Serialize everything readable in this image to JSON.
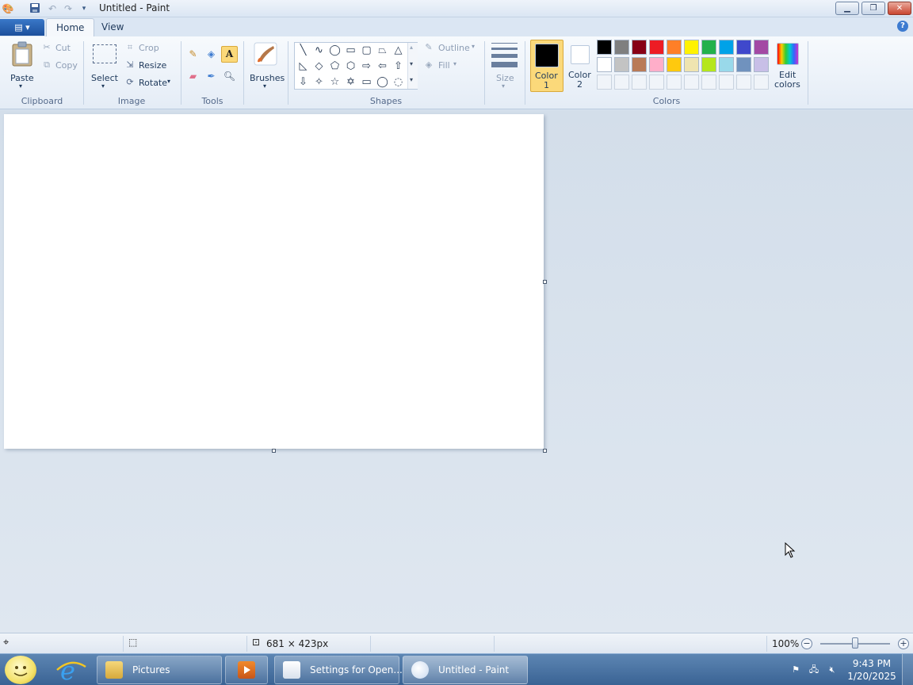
{
  "window": {
    "title": "Untitled - Paint",
    "quick_access": [
      "save-icon",
      "undo-icon",
      "redo-icon",
      "customize-dropdown-icon"
    ],
    "controls": [
      "minimize",
      "restore",
      "close"
    ]
  },
  "ribbon": {
    "app_menu_icon": "paint-menu-icon",
    "tabs": [
      {
        "label": "Home",
        "active": true
      },
      {
        "label": "View",
        "active": false
      }
    ],
    "groups": {
      "clipboard": {
        "label": "Clipboard",
        "paste": "Paste",
        "cut": "Cut",
        "copy": "Copy"
      },
      "image": {
        "label": "Image",
        "select": "Select",
        "crop": "Crop",
        "resize": "Resize",
        "rotate": "Rotate"
      },
      "tools": {
        "label": "Tools",
        "items": [
          "pencil",
          "fill",
          "text",
          "eraser",
          "color-picker",
          "magnifier"
        ],
        "active": "text"
      },
      "brushes": {
        "label": "Brushes"
      },
      "shapes": {
        "label": "Shapes",
        "outline": "Outline",
        "fill": "Fill"
      },
      "size": {
        "label": "Size"
      },
      "colors": {
        "label": "Colors",
        "color1_label": "Color",
        "color1_num": "1",
        "color2_label": "Color",
        "color2_num": "2",
        "color1": "#000000",
        "color2": "#ffffff",
        "edit": "Edit",
        "edit2": "colors",
        "palette_row1": [
          "#000000",
          "#7f7f7f",
          "#880015",
          "#ed1c24",
          "#ff7f27",
          "#fff200",
          "#22b14c",
          "#00a2e8",
          "#3f48cc",
          "#a349a4"
        ],
        "palette_row2": [
          "#ffffff",
          "#c3c3c3",
          "#b97a57",
          "#ffaec9",
          "#ffc90e",
          "#efe4b0",
          "#b5e61d",
          "#99d9ea",
          "#7092be",
          "#c8bfe7"
        ]
      }
    }
  },
  "canvas": {
    "background": "#ffffff"
  },
  "status": {
    "dimensions": "681 × 423px",
    "zoom": "100%",
    "zoom_level": 1.0
  },
  "taskbar": {
    "items": [
      {
        "label": "Pictures",
        "active": false
      },
      {
        "label": "Settings for Open...",
        "active": false
      },
      {
        "label": "Untitled - Paint",
        "active": true
      }
    ],
    "time": "9:43 PM",
    "date": "1/20/2025"
  }
}
